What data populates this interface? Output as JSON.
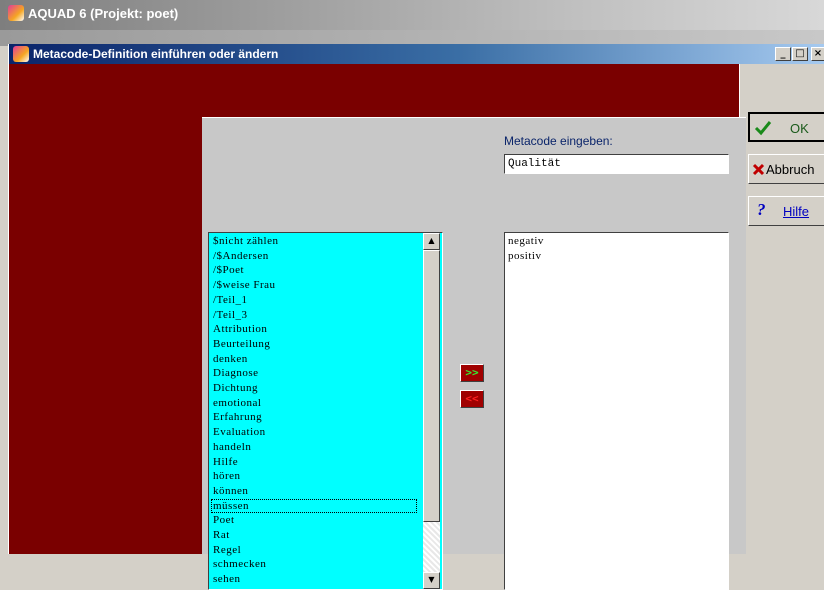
{
  "app": {
    "title": "AQUAD 6 (Projekt: poet)"
  },
  "dialog": {
    "title": "Metacode-Definition einführen oder ändern",
    "minimize": "_",
    "maximize": "□",
    "close": "×"
  },
  "metacode": {
    "label": "Metacode eingeben:",
    "value": "Qualität"
  },
  "left_list": {
    "items": [
      "$nicht zählen",
      "/$Andersen",
      "/$Poet",
      "/$weise Frau",
      "/Teil_1",
      "/Teil_3",
      "Attribution",
      "Beurteilung",
      "denken",
      "Diagnose",
      "Dichtung",
      "emotional",
      "Erfahrung",
      "Evaluation",
      "handeln",
      "Hilfe",
      "hören",
      "können",
      "müssen",
      "Poet",
      "Rat",
      "Regel",
      "schmecken",
      "sehen"
    ],
    "focused_item": "müssen"
  },
  "right_list": {
    "items": [
      "negativ",
      "positiv"
    ]
  },
  "move_buttons": {
    "add": ">>",
    "remove": "<<"
  },
  "actions": {
    "ok_label": "OK",
    "cancel_label": "Abbruch",
    "help_label": "Hilfe"
  },
  "icons": {
    "ok": "checkmark-icon",
    "cancel": "x-icon",
    "help": "question-mark-icon",
    "scroll_up": "arrow-up-icon",
    "scroll_down": "arrow-down-icon"
  },
  "colors": {
    "background_red": "#7a0000",
    "list_cyan": "#00ffff",
    "ok_green": "#1a8a1a",
    "cancel_red": "#c00000",
    "help_blue": "#0000c0",
    "add_arrow_green": "#33ee33",
    "remove_arrow_red": "#ff2020"
  }
}
